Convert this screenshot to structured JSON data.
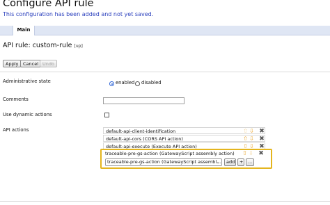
{
  "page_title": "Configure API rule",
  "notice": "This configuration has been added and not yet saved.",
  "tabs": [
    {
      "label": "Main"
    }
  ],
  "rule_heading": {
    "prefix": "API rule: ",
    "name": "custom-rule",
    "up_link": "[up]"
  },
  "actions": {
    "apply": "Apply",
    "cancel": "Cancel",
    "undo": "Undo"
  },
  "fields": {
    "admin_state": {
      "label": "Administrative state",
      "enabled": "enabled",
      "disabled": "disabled",
      "selected": "enabled"
    },
    "comments": {
      "label": "Comments",
      "value": ""
    },
    "dynamic_actions": {
      "label": "Use dynamic actions",
      "checked": false
    },
    "api_actions": {
      "label": "API actions",
      "items": [
        {
          "text": "default-api-client-identification"
        },
        {
          "text": "default-api-cors (CORS API action)"
        },
        {
          "text": "default-api-execute (Execute API action)"
        },
        {
          "text": "traceable-pre-gs-action (GatewayScript assembly action)"
        }
      ],
      "select_value": "traceable-pre-gs-action (GatewayScript assembl…",
      "add_label": "add",
      "plus_label": "+",
      "more_label": "..."
    }
  },
  "icons": {
    "up": "arrow-up-icon",
    "down": "arrow-down-icon",
    "delete": "x-delete-icon"
  },
  "colors": {
    "notice": "#2a3fbd",
    "highlight": "#e4b51e",
    "tabbar": "#dfe6f4",
    "arrows": "#e8a32b"
  }
}
